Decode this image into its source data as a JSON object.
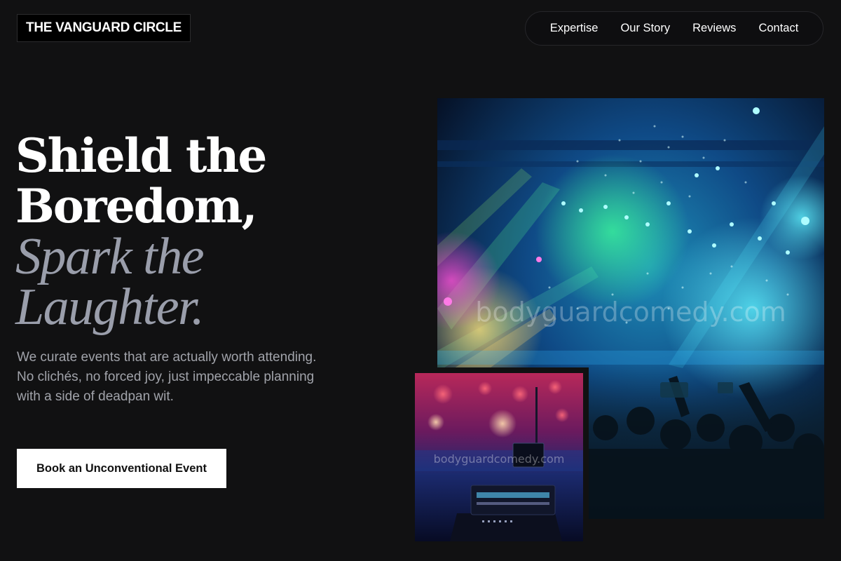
{
  "brand": {
    "name": "THE VANGUARD CIRCLE"
  },
  "nav": {
    "items": [
      {
        "label": "Expertise"
      },
      {
        "label": "Our Story"
      },
      {
        "label": "Reviews"
      },
      {
        "label": "Contact"
      }
    ]
  },
  "hero": {
    "headline_line1": "Shield the",
    "headline_line2": "Boredom,",
    "headline_line3": "Spark the",
    "headline_line4": "Laughter.",
    "subtext": "We curate events that are actually worth attending. No clichés, no forced joy, just impeccable planning with a side of deadpan wit.",
    "cta_label": "Book an Unconventional Event"
  },
  "images": {
    "main_watermark": "bodyguardcomedy.com",
    "secondary_watermark": "bodyguardcomedy.com"
  },
  "colors": {
    "background": "#111112",
    "accent_text": "#9a9eab",
    "cta_background": "#ffffff"
  }
}
